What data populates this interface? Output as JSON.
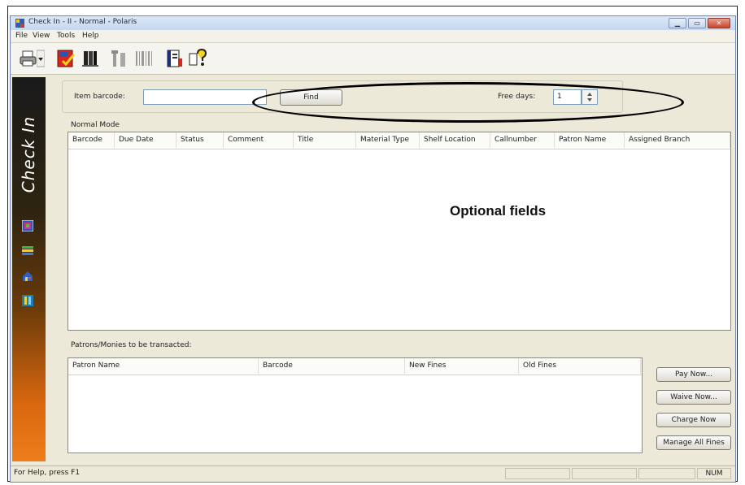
{
  "window": {
    "title": "Check In - II - Normal - Polaris"
  },
  "menu": [
    "File",
    "View",
    "Tools",
    "Help"
  ],
  "toolbar_icons": [
    "printer-icon",
    "printer-dropdown-icon",
    "checkin-icon",
    "bookshelf-icon",
    "tools-icon",
    "barcode-icon",
    "book-icon",
    "help-icon"
  ],
  "sidebar": {
    "title": "Check In",
    "icons": [
      "mode-normal-icon",
      "mode-bulk-icon",
      "mode-inhouse-icon",
      "mode-ill-icon"
    ]
  },
  "search": {
    "item_barcode_label": "Item barcode:",
    "item_barcode_value": "",
    "find_button": "Find",
    "free_days_label": "Free days:",
    "free_days_value": "1"
  },
  "mode_label": "Normal Mode",
  "items_table": {
    "columns": [
      "Barcode",
      "Due Date",
      "Status",
      "Comment",
      "Title",
      "Material Type",
      "Shelf Location",
      "Callnumber",
      "Patron Name",
      "Assigned Branch"
    ]
  },
  "annotation": "Optional fields",
  "patrons_label": "Patrons/Monies to be transacted:",
  "patrons_table": {
    "columns": [
      "Patron Name",
      "Barcode",
      "New Fines",
      "Old Fines"
    ]
  },
  "fine_buttons": {
    "pay": "Pay Now...",
    "waive": "Waive Now...",
    "charge": "Charge Now",
    "manage": "Manage All Fines"
  },
  "status": {
    "help": "For Help, press F1",
    "num": "NUM"
  }
}
